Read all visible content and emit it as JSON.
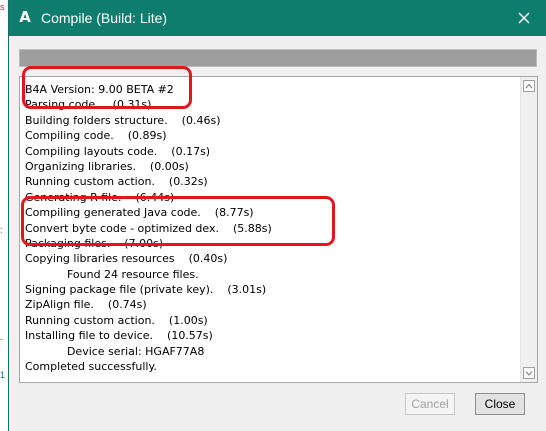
{
  "window": {
    "title": "Compile (Build: Lite)",
    "icon": "b4a-letter-icon",
    "icon_glyph": "A"
  },
  "progress": {
    "fraction": 1.0
  },
  "log": {
    "lines": [
      "B4A Version: 9.00 BETA #2",
      "Parsing code.    (0.31s)",
      "Building folders structure.    (0.46s)",
      "Compiling code.    (0.89s)",
      "Compiling layouts code.    (0.17s)",
      "Organizing libraries.    (0.00s)",
      "Running custom action.    (0.32s)",
      "Generating R file.    (6.44s)",
      "Compiling generated Java code.    (8.77s)",
      "Convert byte code - optimized dex.    (5.88s)",
      "Packaging files.    (7.00s)",
      "Copying libraries resources    (0.40s)",
      "            Found 24 resource files.",
      "Signing package file (private key).    (3.01s)",
      "ZipAlign file.    (0.74s)",
      "Running custom action.    (1.00s)",
      "Installing file to device.    (10.57s)",
      "            Device serial: HGAF77A8",
      "Completed successfully."
    ]
  },
  "buttons": {
    "cancel_label": "Cancel",
    "close_label": "Close"
  },
  "colors": {
    "titlebar": "#0f7d6d",
    "highlight": "#e3161d"
  },
  "background_marks": [
    "s",
    ":",
    "-",
    "1"
  ]
}
